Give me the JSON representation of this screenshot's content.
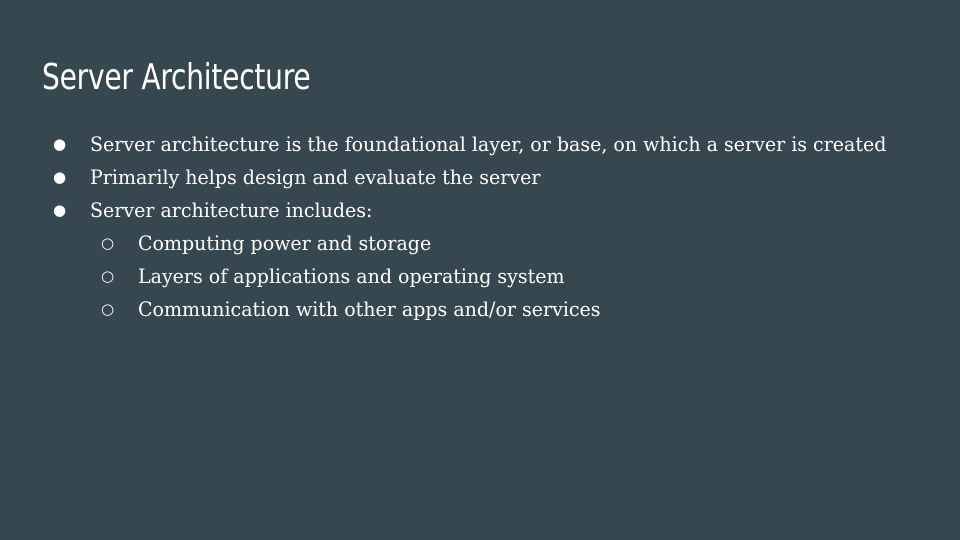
{
  "slide": {
    "background": "#37474f",
    "text_color": "#ffffff",
    "title": "Server Architecture",
    "bullets": [
      {
        "level": 1,
        "marker": "●",
        "text": "Server architecture is the foundational layer, or base, on which a server is created"
      },
      {
        "level": 1,
        "marker": "●",
        "text": "Primarily helps design and evaluate the server"
      },
      {
        "level": 1,
        "marker": "●",
        "text": "Server architecture includes:"
      },
      {
        "level": 2,
        "marker": "○",
        "text": "Computing power and storage"
      },
      {
        "level": 2,
        "marker": "○",
        "text": "Layers of applications and operating system"
      },
      {
        "level": 2,
        "marker": "○",
        "text": "Communication with other apps and/or services"
      }
    ]
  }
}
